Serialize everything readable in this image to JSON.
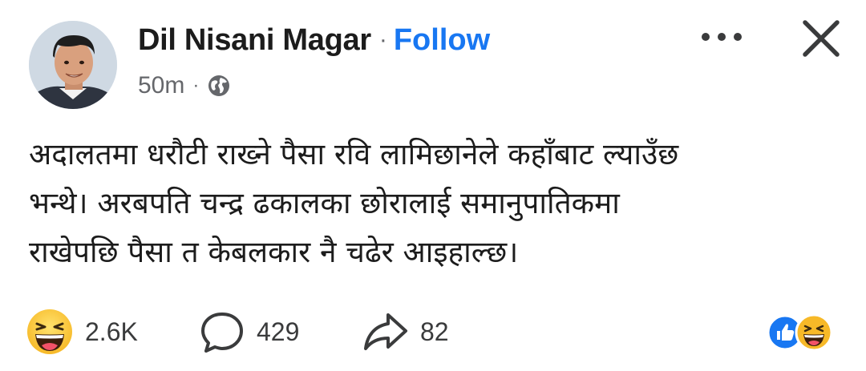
{
  "header": {
    "author_name": "Dil Nisani Magar",
    "separator": "·",
    "follow_label": "Follow",
    "time": "50m",
    "meta_separator": "·",
    "audience_icon": "globe-icon",
    "more_icon": "more-horizontal-icon",
    "close_icon": "close-icon"
  },
  "post": {
    "text_lines": [
      "अदालतमा धरौटी राख्ने पैसा रवि लामिछानेले कहाँबाट ल्याउँछ",
      "भन्थे। अरबपति  चन्द्र ढकालका छोरालाई समानुपातिकमा",
      "राखेपछि पैसा त केबलकार नै चढेर आइहाल्छ।"
    ]
  },
  "footer": {
    "reactions": {
      "icon": "haha-emoji-icon",
      "count": "2.6K"
    },
    "comments": {
      "icon": "comment-icon",
      "count": "429"
    },
    "shares": {
      "icon": "share-icon",
      "count": "82"
    },
    "reaction_summary_icons": [
      "like-reaction-icon",
      "haha-reaction-icon"
    ]
  },
  "colors": {
    "link": "#1877f2",
    "text": "#1c1c1c",
    "secondary": "#65676b",
    "background": "#ffffff"
  }
}
